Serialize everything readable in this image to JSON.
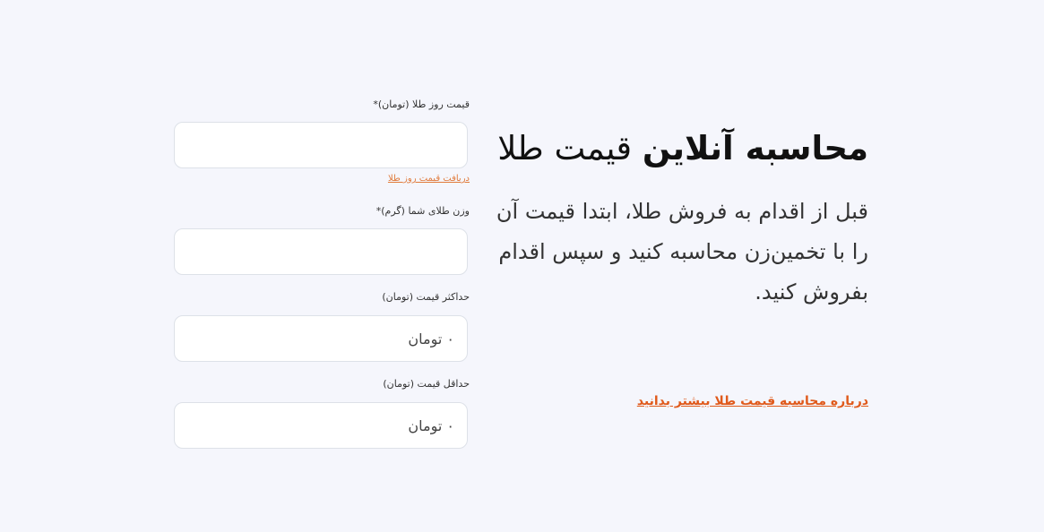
{
  "intro": {
    "headline_bold": "محاسبه آنلاین",
    "headline_rest": " قیمت طلا",
    "lead": "قبل از اقدام به فروش طلا، ابتدا قیمت آن را با تخمین‌زن محاسبه کنید و سپس اقدام بفروش کنید.",
    "more_link": "درباره محاسبه قیمت طلا بیشتر بدانید"
  },
  "form": {
    "gold_price": {
      "label": "قیمت روز طلا (تومان)*",
      "value": "",
      "link": "دریافت قیمت روز طلا"
    },
    "weight": {
      "label": "وزن طلای شما (گرم)*",
      "value": ""
    },
    "max_price": {
      "label": "حداکثر قیمت (تومان)",
      "value": "۰ تومان"
    },
    "min_price": {
      "label": "حداقل قیمت (تومان)",
      "value": "۰ تومان"
    }
  }
}
